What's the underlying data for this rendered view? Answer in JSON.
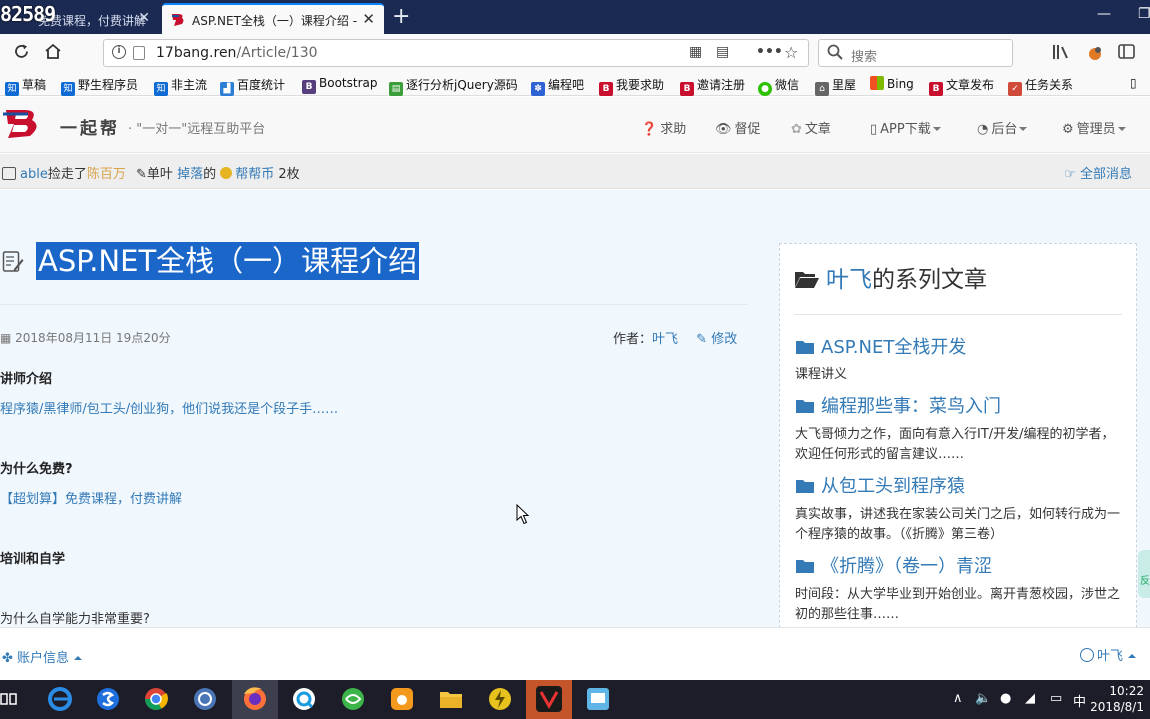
{
  "browser": {
    "overlay_number": "82589",
    "inactive_tab_title": "免费课程，付费讲解",
    "active_tab_title": "ASP.NET全栈（一）课程介绍 -",
    "new_tab_symbol": "+",
    "url_host": "17bang.ren",
    "url_path": "/Article/130",
    "search_placeholder": "搜索",
    "bookmarks": [
      {
        "label": "草稿",
        "icon": "zhi-icon",
        "color": "#0e6bd4"
      },
      {
        "label": "野生程序员",
        "icon": "zhi-icon",
        "color": "#0e6bd4"
      },
      {
        "label": "非主流",
        "icon": "zhi-icon",
        "color": "#0e6bd4"
      },
      {
        "label": "百度统计",
        "icon": "chart-icon",
        "color": "#2d7fd6"
      },
      {
        "label": "Bootstrap",
        "icon": "bootstrap-icon",
        "color": "#563d7c"
      },
      {
        "label": "逐行分析jQuery源码",
        "icon": "doc-icon",
        "color": "#3a9e3a"
      },
      {
        "label": "编程吧",
        "icon": "paw-icon",
        "color": "#2f62d3"
      },
      {
        "label": "我要求助",
        "icon": "site-icon",
        "color": "#c8102e"
      },
      {
        "label": "邀请注册",
        "icon": "site-icon",
        "color": "#c8102e"
      },
      {
        "label": "微信",
        "icon": "wechat-icon",
        "color": "#2dc100"
      },
      {
        "label": "里屋",
        "icon": "hat-icon",
        "color": "#666666"
      },
      {
        "label": "Bing",
        "icon": "windows-icon",
        "color": "#f25022"
      },
      {
        "label": "文章发布",
        "icon": "site-icon",
        "color": "#c8102e"
      },
      {
        "label": "任务关系",
        "icon": "task-icon",
        "color": "#d04a3a"
      }
    ]
  },
  "site": {
    "brand_name": "一起帮",
    "slogan": "· \"一对一\"远程互助平台",
    "nav": {
      "help": "求助",
      "urge": "督促",
      "article": "文章",
      "app": "APP下载",
      "backend": "后台",
      "admin": "管理员"
    },
    "message": {
      "actor": "able",
      "action": "捡走了",
      "target": "陈百万",
      "leaf_prefix": "单叶",
      "dropped": "掉落",
      "of": "的",
      "coin_name": "帮帮币",
      "amount": "2枚"
    },
    "all_messages": "全部消息"
  },
  "article": {
    "title": "ASP.NET全栈（一）课程介绍",
    "date": "2018年08月11日 19点20分",
    "author_label": "作者：",
    "author": "叶飞",
    "edit": "修改",
    "sections": [
      {
        "heading": "讲师介绍",
        "text": "程序猿/黑律师/包工头/创业狗，他们说我还是个段子手……",
        "is_link": true
      },
      {
        "heading": "为什么免费?",
        "text": "【超划算】免费课程，付费讲解",
        "is_link": true
      },
      {
        "heading": "培训和自学",
        "text": "",
        "is_link": false
      },
      {
        "heading": "为什么自学能力非常重要?",
        "text": "",
        "is_link": false
      }
    ]
  },
  "sidebar": {
    "author": "叶飞",
    "title_suffix": "的系列文章",
    "series": [
      {
        "title": "ASP.NET全栈开发",
        "desc": "课程讲义"
      },
      {
        "title": "编程那些事：菜鸟入门",
        "desc": "大飞哥倾力之作，面向有意入行IT/开发/编程的初学者，欢迎任何形式的留言建议……"
      },
      {
        "title": "从包工头到程序猿",
        "desc": "真实故事，讲述我在家装公司关门之后，如何转行成为一个程序猿的故事。（《折腾》第三卷）"
      },
      {
        "title": "《折腾》（卷一）青涩",
        "desc": "时间段：从大学毕业到开始创业。离开青葱校园，涉世之初的那些往事……"
      }
    ],
    "side_tab": "反"
  },
  "footer": {
    "account": "账户信息",
    "user": "叶飞"
  },
  "taskbar": {
    "ime": "中",
    "time": "10:22",
    "date": "2018/8/1"
  }
}
